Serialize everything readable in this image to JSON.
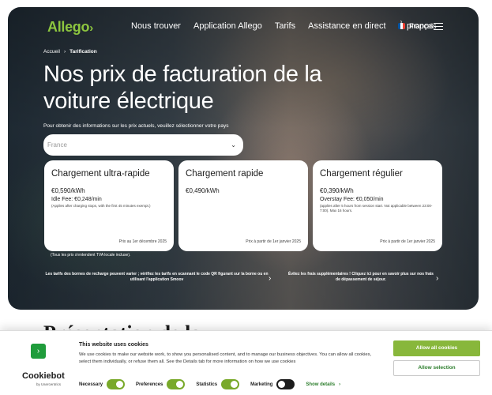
{
  "brand": {
    "logo": "Allego",
    "logo_chevron": "›",
    "accent": "#8dc63f"
  },
  "nav": {
    "items": [
      "Nous trouver",
      "Application Allego",
      "Tarifs",
      "Assistance en direct",
      "À propos"
    ],
    "language": "Français",
    "flag_colors": [
      "#0055a4",
      "#ffffff",
      "#ef4135"
    ],
    "menu_icon": "hamburger-icon"
  },
  "breadcrumb": {
    "home": "Accueil",
    "separator": "›",
    "current": "Tarification"
  },
  "hero": {
    "title": "Nos prix de facturation de la voiture électrique",
    "subtitle": "Pour obtenir des informations sur les prix actuels, veuillez sélectionner votre pays",
    "country_select": {
      "value": "France",
      "chevron": "⌄"
    }
  },
  "cards": [
    {
      "title": "Chargement ultra-rapide",
      "price": "€0,590/kWh",
      "fee": "Idle Fee: €0,248/min",
      "note": "(Applies after charging stops, with the first 45 minutes exempt.)",
      "date": "Prix au 1er décembre 2025"
    },
    {
      "title": "Chargement rapide",
      "price": "€0,490/kWh",
      "fee": "",
      "note": "",
      "date": "Prix à partir de 1er janvier 2025"
    },
    {
      "title": "Chargement régulier",
      "price": "€0,390/kWh",
      "fee": "Overstay Fee: €0,050/min",
      "note": "(applies after 5 hours from session start. Not applicable between 23:00-7:00). Max 16 hours.",
      "date": "Prix à partir de 1er janvier 2025"
    }
  ],
  "vat_note": "(Tous les prix s'entendent TVA locale incluse).",
  "info_links": [
    {
      "text": "Les tarifs des bornes de recharge peuvent varier ; vérifiez les tarifs en scannant le code QR figurant sur la borne ou en utilisant l'application Smoov",
      "arrow": "›"
    },
    {
      "text": "Évitez les frais supplémentaires ! Cliquez ici pour en savoir plus sur nos frais de dépassement de séjour.",
      "arrow": "›"
    }
  ],
  "below_hero_heading": "Présentation de la",
  "cookie": {
    "title": "This website uses cookies",
    "text": "We use cookies to make our website work, to show you personalised content, and to manage our business objectives. You can allow all cookies, select them individually, or refuse them all. See the Details tab for more information on how we use cookies",
    "logo": "Cookiebot",
    "logo_by": "by Usercentrics",
    "check_icon": "›",
    "toggles": [
      {
        "label": "Necessary",
        "on": true
      },
      {
        "label": "Preferences",
        "on": true
      },
      {
        "label": "Statistics",
        "on": true
      },
      {
        "label": "Marketing",
        "on": false
      }
    ],
    "details_label": "Show details",
    "details_arrow": "›",
    "allow_all": "Allow all cookies",
    "allow_selection": "Allow selection",
    "accent": "#88b73b"
  }
}
